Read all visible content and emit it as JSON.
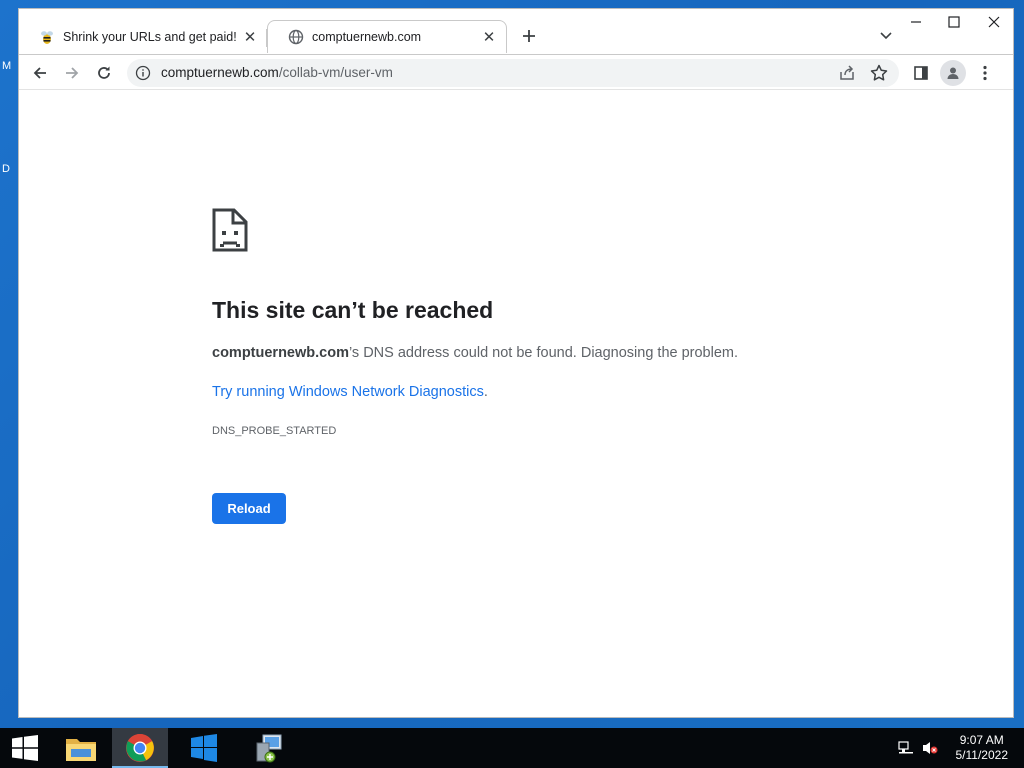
{
  "desktop": {
    "fragment_top": "M",
    "fragment_mid": "D"
  },
  "browser": {
    "tabs": [
      {
        "title": "Shrink your URLs and get paid!",
        "favicon": "bee-icon",
        "active": false
      },
      {
        "title": "comptuernewb.com",
        "favicon": "globe-icon",
        "active": true
      }
    ],
    "address_bar": {
      "host": "comptuernewb.com",
      "path": "/collab-vm/user-vm"
    }
  },
  "error_page": {
    "title": "This site can’t be reached",
    "domain": "comptuernewb.com",
    "description": "’s DNS address could not be found. Diagnosing the problem.",
    "link_text": "Try running Windows Network Diagnostics",
    "link_suffix": ".",
    "error_code": "DNS_PROBE_STARTED",
    "reload_label": "Reload",
    "accent_color": "#1a73e8"
  },
  "taskbar": {
    "items": [
      "start-icon",
      "file-explorer-icon",
      "chrome-icon",
      "server-manager-icon",
      "network-setup-icon"
    ],
    "clock": {
      "time": "9:07 AM",
      "date": "5/11/2022"
    }
  }
}
